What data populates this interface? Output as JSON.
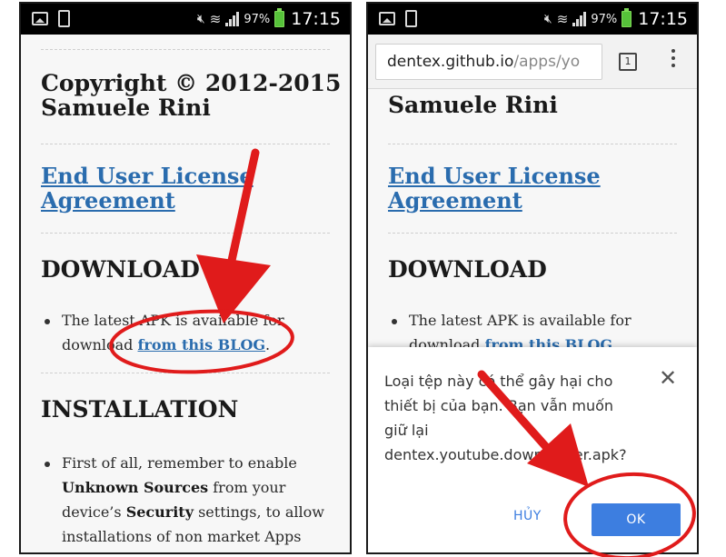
{
  "left_screen": {
    "status": {
      "battery_pct": "97%",
      "time": "17:15"
    },
    "copyright_line1": "Copyright © 2012-2015",
    "copyright_line2": "Samuele Rini",
    "eula_line1": "End User License",
    "eula_line2": "Agreement",
    "download_heading": "DOWNLOAD",
    "download_text_1": "The latest APK is available for",
    "download_text_2": "download",
    "download_link": "from this BLOG",
    "download_period": ".",
    "installation_heading": "INSTALLATION",
    "install_line1": "First of all, remember to enable",
    "install_bold1": "Unknown Sources",
    "install_line2_rest": " from your",
    "install_line3_a": "device’s ",
    "install_bold2": "Security",
    "install_line3_b": " settings, to allow",
    "install_line4": "installations of non market Apps"
  },
  "right_screen": {
    "status": {
      "battery_pct": "97%",
      "time": "17:15"
    },
    "url_host": "dentex.github.io",
    "url_path": "/apps/yo",
    "tab_count": "1",
    "name_line": "Samuele Rini",
    "eula_line1": "End User License",
    "eula_line2": "Agreement",
    "download_heading": "DOWNLOAD",
    "download_text_1": "The latest APK is available for",
    "download_text_2": "download",
    "download_link": "from this BLOG",
    "download_period": ".",
    "dialog": {
      "line1": "Loại tệp này có thể gây hại cho",
      "line2": "thiết bị của bạn. Bạn vẫn muốn",
      "line3": "giữ lại",
      "line4": "dentex.youtube.downloader.apk?",
      "cancel_label": "HỦY",
      "ok_label": "OK"
    }
  },
  "colors": {
    "link": "#2a6cae",
    "dialog_button": "#3d7ee0",
    "annotation_red": "#e01b1b"
  },
  "icons": [
    "picture-icon",
    "phone-icon",
    "mute-icon",
    "wifi-icon",
    "signal-icon",
    "battery-icon",
    "close-icon",
    "tab-switcher-icon",
    "overflow-menu-icon",
    "annotation-arrow",
    "annotation-circle"
  ]
}
